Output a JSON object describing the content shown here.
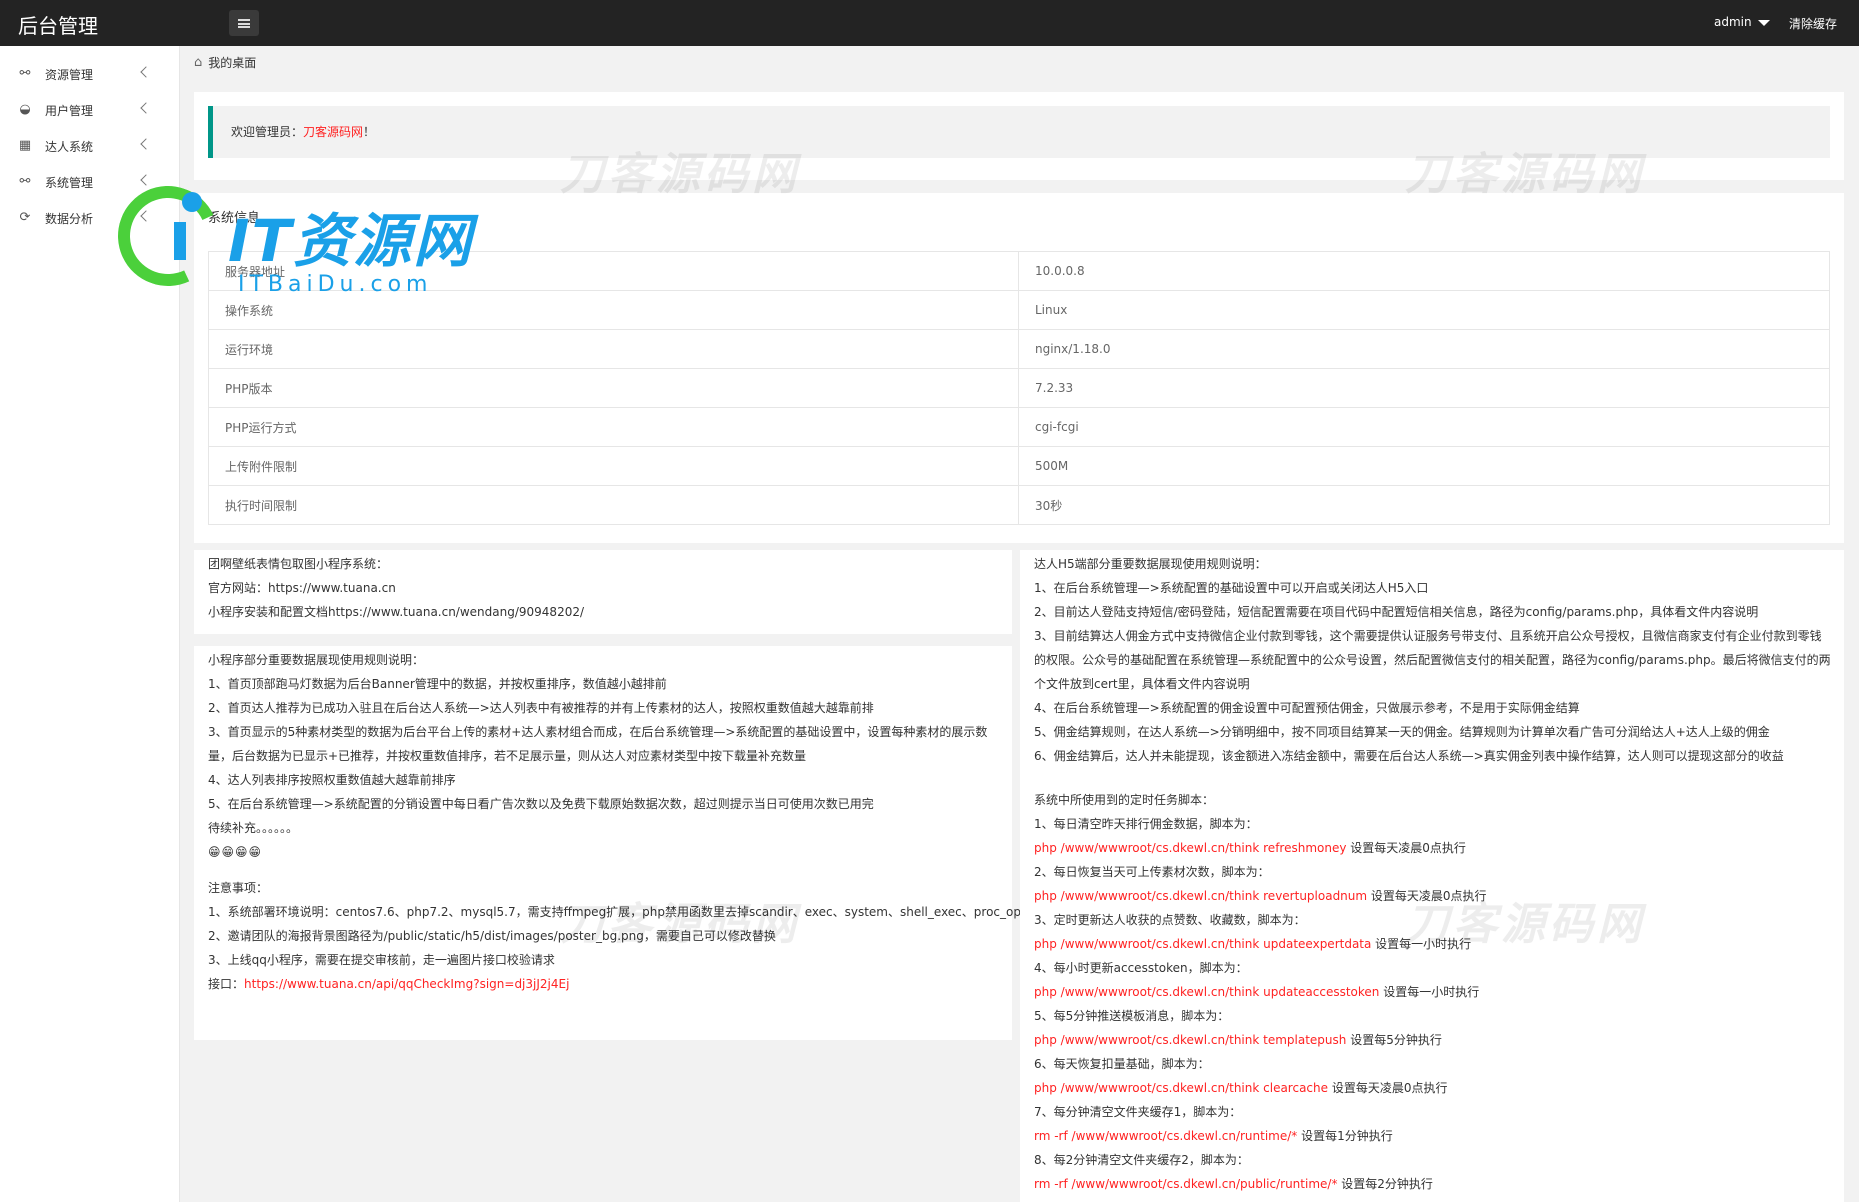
{
  "topbar": {
    "brand": "后台管理",
    "user": "admin",
    "clear_cache": "清除缓存"
  },
  "sidebar": {
    "items": [
      {
        "label": "资源管理",
        "icon": "user-icon"
      },
      {
        "label": "用户管理",
        "icon": "palette-icon"
      },
      {
        "label": "达人系统",
        "icon": "grid-icon"
      },
      {
        "label": "系统管理",
        "icon": "user-admin-icon"
      },
      {
        "label": "数据分析",
        "icon": "refresh-icon"
      }
    ]
  },
  "breadcrumb": "我的桌面",
  "welcome": {
    "prefix": "欢迎管理员：",
    "site": "刀客源码网",
    "suffix": "！"
  },
  "sysinfo": {
    "title": "系统信息",
    "rows": [
      {
        "k": "服务器地址",
        "v": "10.0.0.8"
      },
      {
        "k": "操作系统",
        "v": "Linux"
      },
      {
        "k": "运行环境",
        "v": "nginx/1.18.0"
      },
      {
        "k": "PHP版本",
        "v": "7.2.33"
      },
      {
        "k": "PHP运行方式",
        "v": "cgi-fcgi"
      },
      {
        "k": "上传附件限制",
        "v": "500M"
      },
      {
        "k": "执行时间限制",
        "v": "30秒"
      }
    ]
  },
  "left_card1": [
    "团啊壁纸表情包取图小程序系统：",
    "官方网站：https://www.tuana.cn",
    "小程序安装和配置文档https://www.tuana.cn/wendang/90948202/"
  ],
  "left_card2": {
    "lines": [
      "小程序部分重要数据展现使用规则说明：",
      "1、首页顶部跑马灯数据为后台Banner管理中的数据，并按权重排序，数值越小越排前",
      "2、首页达人推荐为已成功入驻且在后台达人系统—>达人列表中有被推荐的并有上传素材的达人，按照权重数值越大越靠前排",
      "3、首页显示的5种素材类型的数据为后台平台上传的素材+达人素材组合而成，在后台系统管理—>系统配置的基础设置中，设置每种素材的展示数",
      "量，后台数据为已显示+已推荐，并按权重数值排序，若不足展示量，则从达人对应素材类型中按下载量补充数量",
      "4、达人列表排序按照权重数值越大越靠前排序",
      "5、在后台系统管理—>系统配置的分销设置中每日看广告次数以及免费下载原始数据次数，超过则提示当日可使用次数已用完",
      "待续补充。。。。。。"
    ],
    "emoji": "😁😁😁😁",
    "notes_title": "注意事项：",
    "notes": [
      "1、系统部署环境说明：centos7.6、php7.2、mysql5.7，需支持ffmpeg扩展，php禁用函数里去掉scandir、exec、system、shell_exec、proc_open",
      "2、邀请团队的海报背景图路径为/public/static/h5/dist/images/poster_bg.png，需要自己可以修改替换",
      "3、上线qq小程序，需要在提交审核前，走一遍图片接口校验请求"
    ],
    "api_label": "接口：",
    "api_url": "https://www.tuana.cn/api/qqCheckImg?sign=dj3jJ2j4Ej"
  },
  "right_card": {
    "title": "达人H5端部分重要数据展现使用规则说明：",
    "lines": [
      "1、在后台系统管理—>系统配置的基础设置中可以开启或关闭达人H5入口",
      "2、目前达人登陆支持短信/密码登陆，短信配置需要在项目代码中配置短信相关信息，路径为config/params.php，具体看文件内容说明",
      "3、目前结算达人佣金方式中支持微信企业付款到零钱，这个需要提供认证服务号带支付、且系统开启公众号授权，且微信商家支付有企业付款到零钱",
      "的权限。公众号的基础配置在系统管理—系统配置中的公众号设置，然后配置微信支付的相关配置，路径为config/params.php。最后将微信支付的两",
      "个文件放到cert里，具体看文件内容说明",
      "4、在后台系统管理—>系统配置的佣金设置中可配置预估佣金，只做展示参考，不是用于实际佣金结算",
      "5、佣金结算规则，在达人系统—>分销明细中，按不同项目结算某一天的佣金。结算规则为计算单次看广告可分润给达人+达人上级的佣金",
      "6、佣金结算后，达人并未能提现，该金额进入冻结金额中，需要在后台达人系统—>真实佣金列表中操作结算，达人则可以提现这部分的收益"
    ],
    "cron_title": "系统中所使用到的定时任务脚本：",
    "cron": [
      {
        "desc": "1、每日清空昨天排行佣金数据，脚本为：",
        "cmd": "php /www/wwwroot/cs.dkewl.cn/think refreshmoney",
        "when": " 设置每天凌晨0点执行"
      },
      {
        "desc": "2、每日恢复当天可上传素材次数，脚本为：",
        "cmd": "php /www/wwwroot/cs.dkewl.cn/think revertuploadnum",
        "when": " 设置每天凌晨0点执行"
      },
      {
        "desc": "3、定时更新达人收获的点赞数、收藏数，脚本为：",
        "cmd": "php /www/wwwroot/cs.dkewl.cn/think updateexpertdata",
        "when": " 设置每一小时执行"
      },
      {
        "desc": "4、每小时更新accesstoken，脚本为：",
        "cmd": "php /www/wwwroot/cs.dkewl.cn/think updateaccesstoken",
        "when": " 设置每一小时执行"
      },
      {
        "desc": "5、每5分钟推送模板消息，脚本为：",
        "cmd": "php /www/wwwroot/cs.dkewl.cn/think templatepush",
        "when": " 设置每5分钟执行"
      },
      {
        "desc": "6、每天恢复扣量基础，脚本为：",
        "cmd": "php /www/wwwroot/cs.dkewl.cn/think clearcache",
        "when": " 设置每天凌晨0点执行"
      },
      {
        "desc": "7、每分钟清空文件夹缓存1，脚本为：",
        "cmd": "rm -rf /www/wwwroot/cs.dkewl.cn/runtime/*",
        "when": " 设置每1分钟执行"
      },
      {
        "desc": "8、每2分钟清空文件夹缓存2，脚本为：",
        "cmd": "rm -rf /www/wwwroot/cs.dkewl.cn/public/runtime/*",
        "when": " 设置每2分钟执行"
      }
    ]
  },
  "watermarks": [
    "刀客源码网",
    "刀客源码网",
    "刀客源码网",
    "刀客源码网"
  ],
  "logo": {
    "title": "IT资源网",
    "sub": "ITBaiDu.com"
  },
  "colors": {
    "accent": "#009688",
    "red": "#ff2222",
    "topbar": "#232323",
    "logo_blue": "#1aa0e8",
    "logo_green": "#4bd03b"
  }
}
